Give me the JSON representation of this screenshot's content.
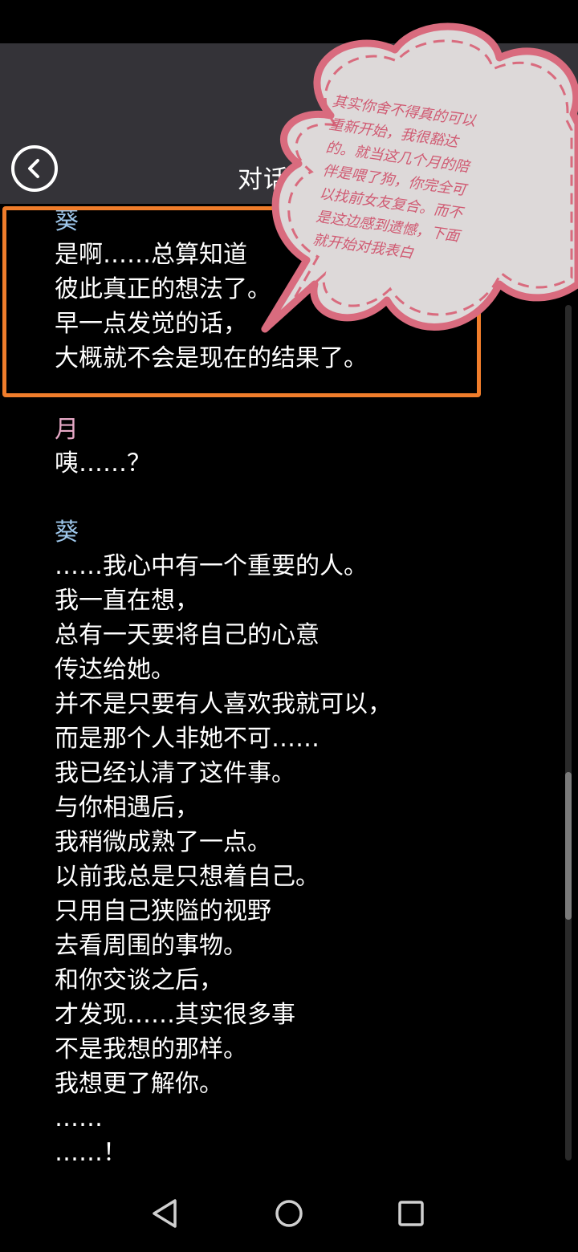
{
  "header": {
    "title": "对话记录",
    "back_icon": "chevron-left-icon"
  },
  "log": [
    {
      "speaker": "葵",
      "lines": [
        "是啊……总算知道",
        "彼此真正的想法了。",
        "早一点发觉的话，",
        "大概就不会是现在的结果了。"
      ]
    },
    {
      "speaker": "月",
      "lines": [
        "咦……？"
      ]
    },
    {
      "speaker": "葵",
      "lines": [
        "……我心中有一个重要的人。",
        "我一直在想，",
        "总有一天要将自己的心意",
        "传达给她。",
        "并不是只要有人喜欢我就可以，",
        "而是那个人非她不可……",
        "我已经认清了这件事。",
        "与你相遇后，",
        "我稍微成熟了一点。",
        "以前我总是只想着自己。",
        "只用自己狭隘的视野",
        "去看周围的事物。",
        "和你交谈之后，",
        "才发现……其实很多事",
        "不是我想的那样。",
        "我想更了解你。",
        "……",
        "……！"
      ]
    }
  ],
  "annotation": {
    "lines": [
      "其实你舍不得真的可以",
      "重新开始，我很豁达",
      "的。就当这几个月的陪",
      "伴是喂了狗，你完全可",
      "以找前女友复合。而不",
      "是这边感到遗憾，下面",
      "就开始对我表白"
    ]
  },
  "colors": {
    "header_bg": "#343338",
    "highlight": "#f07d2b",
    "speaker_kui": "#9dc6ea",
    "speaker_yue": "#e7a9c6",
    "bubble_fill": "#ddd9d9",
    "bubble_stroke": "#d96b7e"
  },
  "nav": {
    "back_icon": "triangle-back-icon",
    "home_icon": "circle-home-icon",
    "recents_icon": "square-recents-icon"
  }
}
